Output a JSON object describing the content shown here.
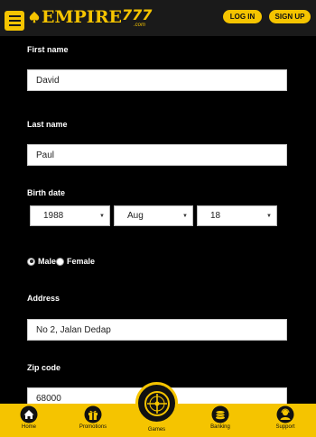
{
  "header": {
    "logo_word": "EMPIRE",
    "logo_number": "777",
    "logo_suffix": ".com",
    "login_label": "LOG IN",
    "signup_label": "SIGN UP"
  },
  "form": {
    "first_name": {
      "label": "First name",
      "value": "David"
    },
    "last_name": {
      "label": "Last name",
      "value": "Paul"
    },
    "birth_date": {
      "label": "Birth date",
      "year": "1988",
      "month": "Aug",
      "day": "18"
    },
    "gender": {
      "male_label": "Male",
      "female_label": "Female",
      "selected": "Male"
    },
    "address": {
      "label": "Address",
      "value": "No 2, Jalan Dedap"
    },
    "zip_code": {
      "label": "Zip code",
      "value": "68000"
    }
  },
  "bottom_nav": {
    "home": "Home",
    "promotions": "Promotions",
    "games": "Games",
    "banking": "Banking",
    "support": "Support"
  },
  "colors": {
    "accent": "#f5c400",
    "background": "#000000",
    "header_bg": "#1a1a1a"
  }
}
